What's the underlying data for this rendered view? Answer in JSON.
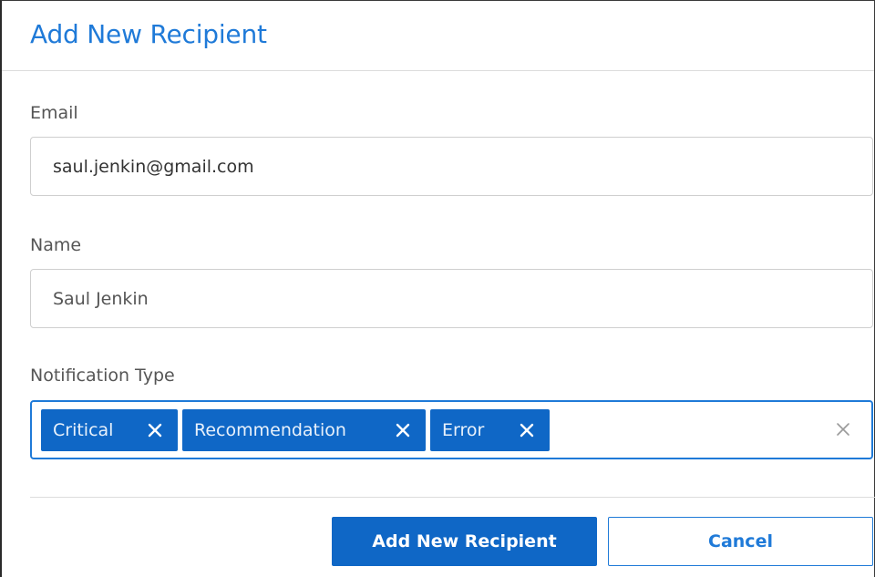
{
  "dialog": {
    "title": "Add New Recipient"
  },
  "email": {
    "label": "Email",
    "value": "saul.jenkin@gmail.com"
  },
  "name": {
    "label": "Name",
    "value": "Saul Jenkin"
  },
  "notification_type": {
    "label": "Notification Type",
    "chips": [
      {
        "label": "Critical",
        "remove_icon": "close-icon"
      },
      {
        "label": "Recommendation",
        "remove_icon": "close-icon"
      },
      {
        "label": "Error",
        "remove_icon": "close-icon"
      }
    ],
    "clear_icon": "close-icon"
  },
  "buttons": {
    "submit_label": "Add New Recipient",
    "cancel_label": "Cancel"
  },
  "colors": {
    "accent": "#1f7ad8",
    "chip_bg": "#0f67c6",
    "button_primary": "#0f67c6"
  }
}
